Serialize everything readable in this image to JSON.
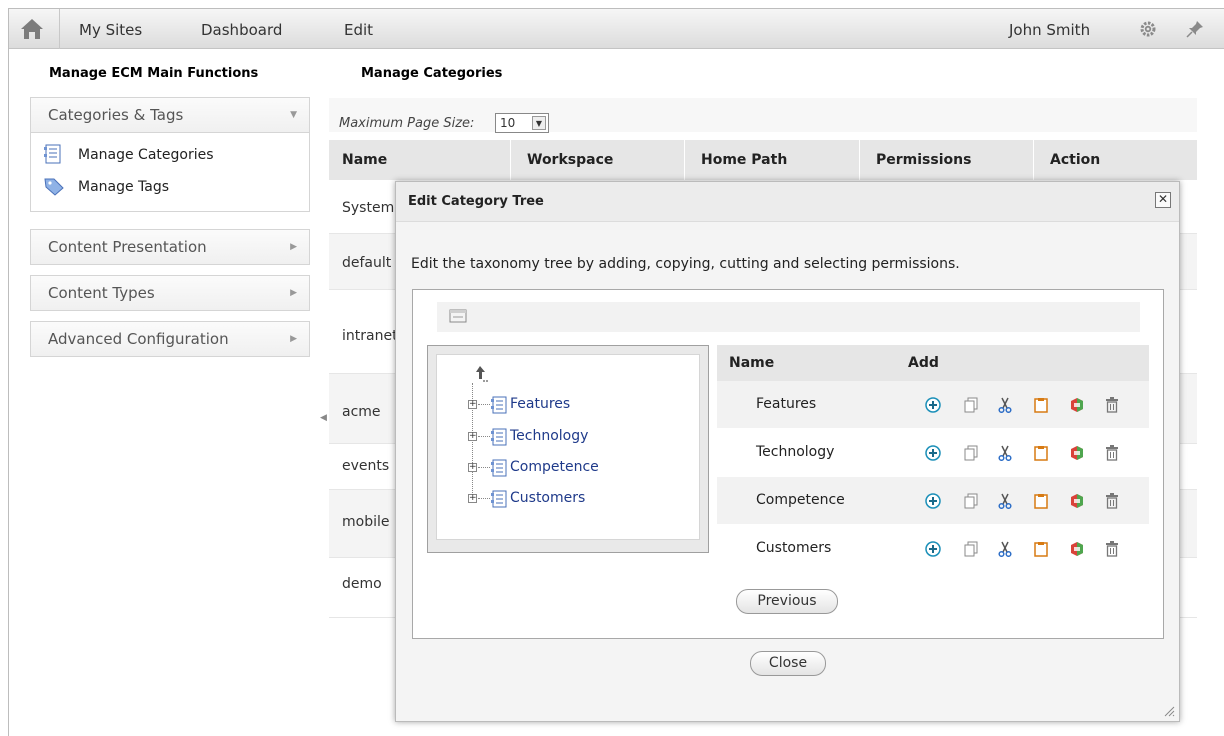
{
  "topbar": {
    "links": [
      "My Sites",
      "Dashboard",
      "Edit"
    ],
    "user_name": "John Smith"
  },
  "sidebar": {
    "title": "Manage ECM Main Functions",
    "panels": [
      {
        "label": "Categories & Tags",
        "expanded": true,
        "items": [
          "Manage Categories",
          "Manage Tags"
        ]
      },
      {
        "label": "Content Presentation",
        "expanded": false
      },
      {
        "label": "Content Types",
        "expanded": false
      },
      {
        "label": "Advanced Configuration",
        "expanded": false
      }
    ]
  },
  "main": {
    "title": "Manage Categories",
    "page_size_label": "Maximum Page Size:",
    "page_size_value": "10",
    "columns": [
      "Name",
      "Workspace",
      "Home Path",
      "Permissions",
      "Action"
    ],
    "rows": [
      "System",
      "default",
      "intranet",
      "acme",
      "events",
      "mobile",
      "demo"
    ]
  },
  "modal": {
    "title": "Edit Category Tree",
    "description": "Edit the taxonomy tree by adding, copying, cutting and selecting permissions.",
    "tree_nodes": [
      "Features",
      "Technology",
      "Competence",
      "Customers"
    ],
    "table_columns": [
      "Name",
      "Add"
    ],
    "table_rows": [
      "Features",
      "Technology",
      "Competence",
      "Customers"
    ],
    "previous_label": "Previous",
    "close_label": "Close"
  },
  "colors": {
    "link_blue": "#1f3a8a",
    "add_icon": "#1a8fb8",
    "cut_icon": "#2f6fc7",
    "paste_icon": "#d77a12",
    "permission_icon": "#d9433a"
  }
}
